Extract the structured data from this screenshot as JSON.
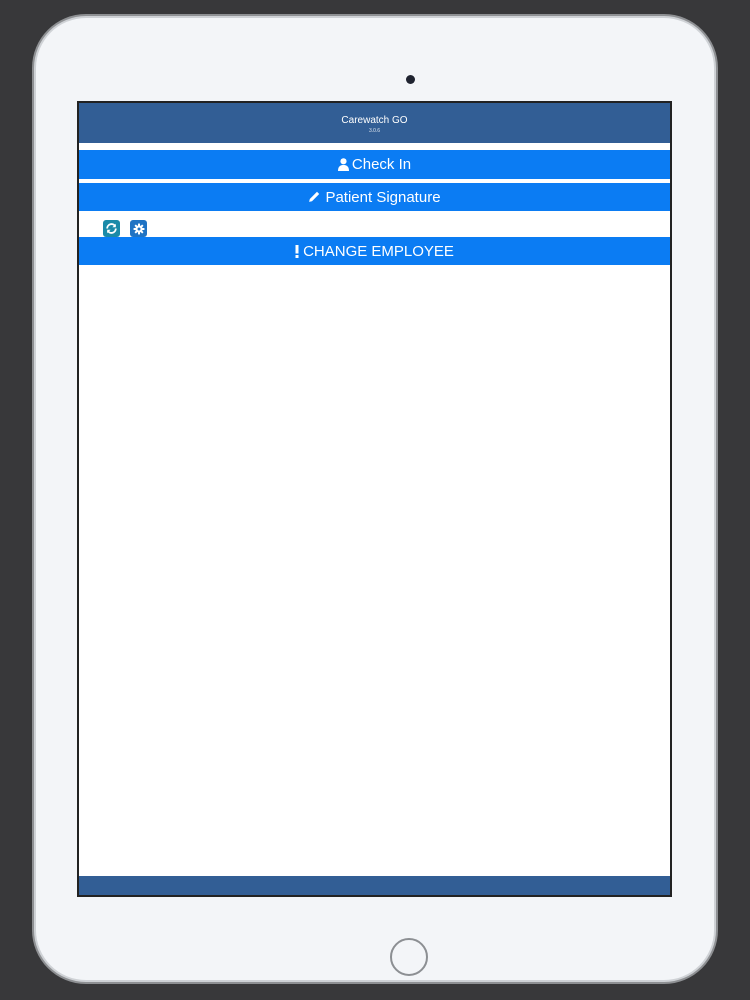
{
  "app": {
    "title": "Carewatch GO",
    "version": "3.0.6"
  },
  "buttons": {
    "check_in": "Check In",
    "patient_signature": "Patient Signature",
    "change_employee": "CHANGE EMPLOYEE"
  },
  "icons": {
    "check_in": "user-icon",
    "patient_signature": "pencil-icon",
    "change_employee": "exclamation-icon",
    "refresh": "refresh-icon",
    "settings": "gear-icon"
  },
  "colors": {
    "header": "#325e95",
    "button": "#0b7cf3",
    "refresh": "#1a8aa8",
    "settings": "#1f73c4"
  }
}
